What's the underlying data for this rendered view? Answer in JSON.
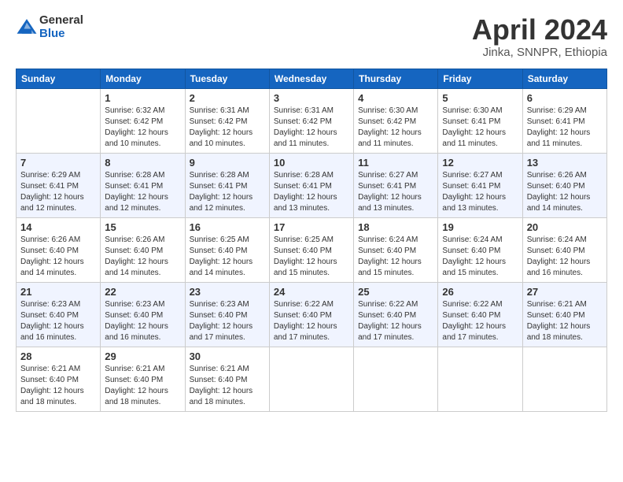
{
  "header": {
    "logo": {
      "line1": "General",
      "line2": "Blue"
    },
    "title": "April 2024",
    "location": "Jinka, SNNPR, Ethiopia"
  },
  "days_of_week": [
    "Sunday",
    "Monday",
    "Tuesday",
    "Wednesday",
    "Thursday",
    "Friday",
    "Saturday"
  ],
  "weeks": [
    [
      {
        "day": "",
        "info": ""
      },
      {
        "day": "1",
        "info": "Sunrise: 6:32 AM\nSunset: 6:42 PM\nDaylight: 12 hours\nand 10 minutes."
      },
      {
        "day": "2",
        "info": "Sunrise: 6:31 AM\nSunset: 6:42 PM\nDaylight: 12 hours\nand 10 minutes."
      },
      {
        "day": "3",
        "info": "Sunrise: 6:31 AM\nSunset: 6:42 PM\nDaylight: 12 hours\nand 11 minutes."
      },
      {
        "day": "4",
        "info": "Sunrise: 6:30 AM\nSunset: 6:42 PM\nDaylight: 12 hours\nand 11 minutes."
      },
      {
        "day": "5",
        "info": "Sunrise: 6:30 AM\nSunset: 6:41 PM\nDaylight: 12 hours\nand 11 minutes."
      },
      {
        "day": "6",
        "info": "Sunrise: 6:29 AM\nSunset: 6:41 PM\nDaylight: 12 hours\nand 11 minutes."
      }
    ],
    [
      {
        "day": "7",
        "info": "Sunrise: 6:29 AM\nSunset: 6:41 PM\nDaylight: 12 hours\nand 12 minutes."
      },
      {
        "day": "8",
        "info": "Sunrise: 6:28 AM\nSunset: 6:41 PM\nDaylight: 12 hours\nand 12 minutes."
      },
      {
        "day": "9",
        "info": "Sunrise: 6:28 AM\nSunset: 6:41 PM\nDaylight: 12 hours\nand 12 minutes."
      },
      {
        "day": "10",
        "info": "Sunrise: 6:28 AM\nSunset: 6:41 PM\nDaylight: 12 hours\nand 13 minutes."
      },
      {
        "day": "11",
        "info": "Sunrise: 6:27 AM\nSunset: 6:41 PM\nDaylight: 12 hours\nand 13 minutes."
      },
      {
        "day": "12",
        "info": "Sunrise: 6:27 AM\nSunset: 6:41 PM\nDaylight: 12 hours\nand 13 minutes."
      },
      {
        "day": "13",
        "info": "Sunrise: 6:26 AM\nSunset: 6:40 PM\nDaylight: 12 hours\nand 14 minutes."
      }
    ],
    [
      {
        "day": "14",
        "info": "Sunrise: 6:26 AM\nSunset: 6:40 PM\nDaylight: 12 hours\nand 14 minutes."
      },
      {
        "day": "15",
        "info": "Sunrise: 6:26 AM\nSunset: 6:40 PM\nDaylight: 12 hours\nand 14 minutes."
      },
      {
        "day": "16",
        "info": "Sunrise: 6:25 AM\nSunset: 6:40 PM\nDaylight: 12 hours\nand 14 minutes."
      },
      {
        "day": "17",
        "info": "Sunrise: 6:25 AM\nSunset: 6:40 PM\nDaylight: 12 hours\nand 15 minutes."
      },
      {
        "day": "18",
        "info": "Sunrise: 6:24 AM\nSunset: 6:40 PM\nDaylight: 12 hours\nand 15 minutes."
      },
      {
        "day": "19",
        "info": "Sunrise: 6:24 AM\nSunset: 6:40 PM\nDaylight: 12 hours\nand 15 minutes."
      },
      {
        "day": "20",
        "info": "Sunrise: 6:24 AM\nSunset: 6:40 PM\nDaylight: 12 hours\nand 16 minutes."
      }
    ],
    [
      {
        "day": "21",
        "info": "Sunrise: 6:23 AM\nSunset: 6:40 PM\nDaylight: 12 hours\nand 16 minutes."
      },
      {
        "day": "22",
        "info": "Sunrise: 6:23 AM\nSunset: 6:40 PM\nDaylight: 12 hours\nand 16 minutes."
      },
      {
        "day": "23",
        "info": "Sunrise: 6:23 AM\nSunset: 6:40 PM\nDaylight: 12 hours\nand 17 minutes."
      },
      {
        "day": "24",
        "info": "Sunrise: 6:22 AM\nSunset: 6:40 PM\nDaylight: 12 hours\nand 17 minutes."
      },
      {
        "day": "25",
        "info": "Sunrise: 6:22 AM\nSunset: 6:40 PM\nDaylight: 12 hours\nand 17 minutes."
      },
      {
        "day": "26",
        "info": "Sunrise: 6:22 AM\nSunset: 6:40 PM\nDaylight: 12 hours\nand 17 minutes."
      },
      {
        "day": "27",
        "info": "Sunrise: 6:21 AM\nSunset: 6:40 PM\nDaylight: 12 hours\nand 18 minutes."
      }
    ],
    [
      {
        "day": "28",
        "info": "Sunrise: 6:21 AM\nSunset: 6:40 PM\nDaylight: 12 hours\nand 18 minutes."
      },
      {
        "day": "29",
        "info": "Sunrise: 6:21 AM\nSunset: 6:40 PM\nDaylight: 12 hours\nand 18 minutes."
      },
      {
        "day": "30",
        "info": "Sunrise: 6:21 AM\nSunset: 6:40 PM\nDaylight: 12 hours\nand 18 minutes."
      },
      {
        "day": "",
        "info": ""
      },
      {
        "day": "",
        "info": ""
      },
      {
        "day": "",
        "info": ""
      },
      {
        "day": "",
        "info": ""
      }
    ]
  ]
}
